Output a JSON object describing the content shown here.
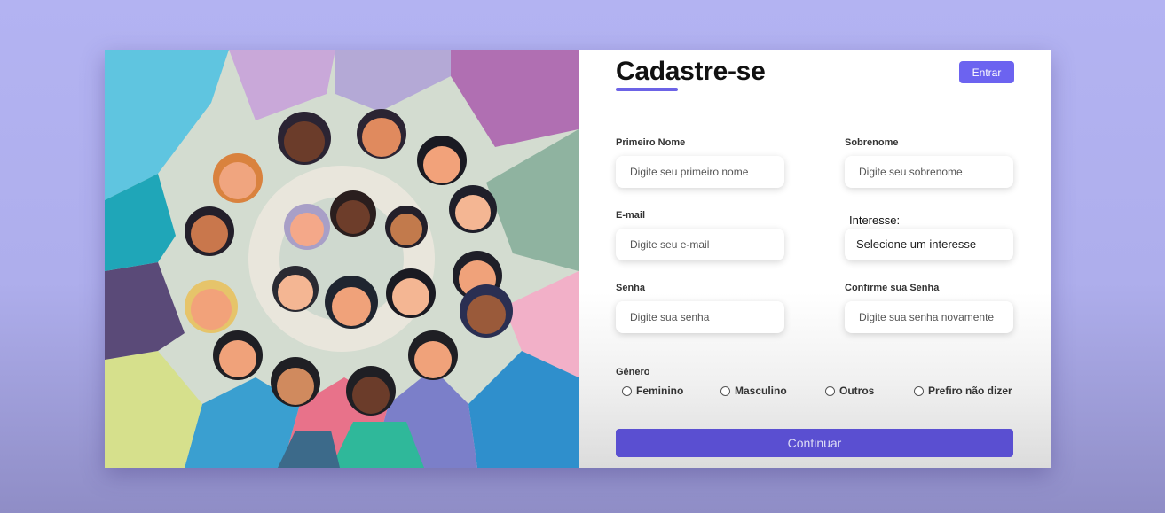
{
  "form": {
    "title": "Cadastre-se",
    "login_label": "Entrar",
    "first_name": {
      "label": "Primeiro Nome",
      "placeholder": "Digite seu primeiro nome"
    },
    "last_name": {
      "label": "Sobrenome",
      "placeholder": "Digite seu sobrenome"
    },
    "email": {
      "label": "E-mail",
      "placeholder": "Digite seu e-mail"
    },
    "interest": {
      "label": "Interesse:",
      "selected": "Selecione um interesse"
    },
    "password": {
      "label": "Senha",
      "placeholder": "Digite sua senha"
    },
    "confirm_password": {
      "label": "Confirme sua Senha",
      "placeholder": "Digite sua senha novamente"
    },
    "gender": {
      "label": "Gênero",
      "options": [
        "Feminino",
        "Masculino",
        "Outros",
        "Prefiro não dizer"
      ]
    },
    "continue_label": "Continuar"
  },
  "colors": {
    "accent": "#6c63f0",
    "button_primary": "#5a4fd1",
    "page_background": "#b3b3f2"
  }
}
